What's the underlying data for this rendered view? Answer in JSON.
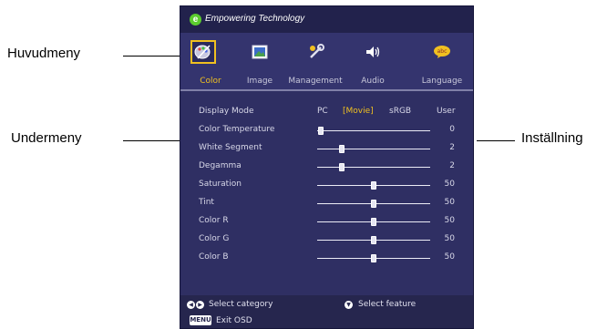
{
  "callouts": {
    "main_menu": "Huvudmeny",
    "submenu": "Undermeny",
    "setting": "Inställning"
  },
  "osd": {
    "brand": "Empowering Technology",
    "brand_logo_letter": "e",
    "menu": [
      {
        "label": "Color",
        "icon": "color-palette-icon",
        "active": true
      },
      {
        "label": "Image",
        "icon": "picture-icon",
        "active": false
      },
      {
        "label": "Management",
        "icon": "tools-icon",
        "active": false
      },
      {
        "label": "Audio",
        "icon": "speaker-icon",
        "active": false
      },
      {
        "label": "Language",
        "icon": "language-bubble-icon",
        "active": false
      }
    ],
    "display_mode": {
      "label": "Display Mode",
      "options": [
        "PC",
        "[Movie]",
        "sRGB",
        "User"
      ],
      "selected": "[Movie]"
    },
    "settings": [
      {
        "label": "Color Temperature",
        "value": "0",
        "level": 0.03
      },
      {
        "label": "White Segment",
        "value": "2",
        "level": 0.22
      },
      {
        "label": "Degamma",
        "value": "2",
        "level": 0.22
      },
      {
        "label": "Saturation",
        "value": "50",
        "level": 0.5
      },
      {
        "label": "Tint",
        "value": "50",
        "level": 0.5
      },
      {
        "label": "Color R",
        "value": "50",
        "level": 0.5
      },
      {
        "label": "Color G",
        "value": "50",
        "level": 0.5
      },
      {
        "label": "Color B",
        "value": "50",
        "level": 0.5
      }
    ],
    "footer": {
      "select_category": "Select category",
      "select_feature": "Select feature",
      "menu_key": "MENU",
      "exit": "Exit OSD"
    }
  },
  "colors": {
    "panel": "#2f2f63",
    "accent": "#f0c020"
  }
}
